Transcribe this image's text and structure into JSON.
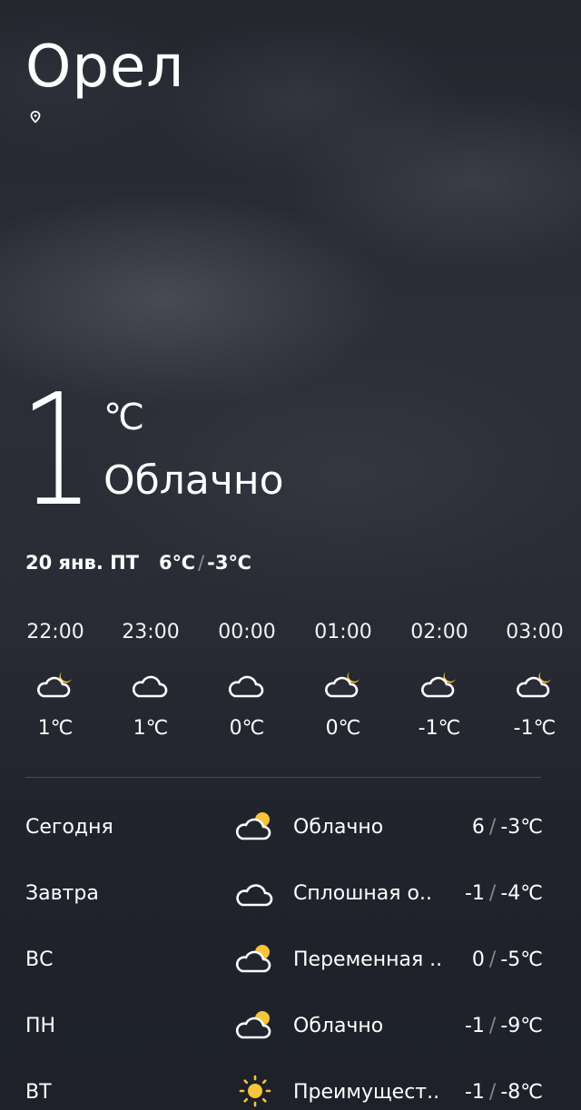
{
  "current": {
    "city": "Орел",
    "location_icon": "location-pin-icon",
    "temperature": "1",
    "unit": "℃",
    "condition": "Облачно",
    "date": "20 янв. ПТ",
    "high": "6℃",
    "low": "-3℃"
  },
  "hourly": [
    {
      "time": "22:00",
      "icon": "cloud-moon-icon",
      "temp": "1℃"
    },
    {
      "time": "23:00",
      "icon": "cloud-icon",
      "temp": "1℃"
    },
    {
      "time": "00:00",
      "icon": "cloud-icon",
      "temp": "0℃"
    },
    {
      "time": "01:00",
      "icon": "cloud-moon-icon",
      "temp": "0℃"
    },
    {
      "time": "02:00",
      "icon": "cloud-moon-icon",
      "temp": "-1℃"
    },
    {
      "time": "03:00",
      "icon": "cloud-moon-icon",
      "temp": "-1℃"
    }
  ],
  "daily": [
    {
      "day": "Сегодня",
      "icon": "cloud-sun-icon",
      "condition": "Облачно",
      "high": "6",
      "low": "-3℃"
    },
    {
      "day": "Завтра",
      "icon": "cloud-icon",
      "condition": "Сплошная о..",
      "high": "-1",
      "low": "-4℃"
    },
    {
      "day": "ВС",
      "icon": "cloud-sun-icon",
      "condition": "Переменная ..",
      "high": "0",
      "low": "-5℃"
    },
    {
      "day": "ПН",
      "icon": "cloud-sun-icon",
      "condition": "Облачно",
      "high": "-1",
      "low": "-9℃"
    },
    {
      "day": "ВТ",
      "icon": "sun-icon",
      "condition": "Преимущест..",
      "high": "-1",
      "low": "-8℃"
    }
  ],
  "colors": {
    "accent_yellow": "#f5c53a",
    "background": "#20232c",
    "text": "#ffffff"
  }
}
